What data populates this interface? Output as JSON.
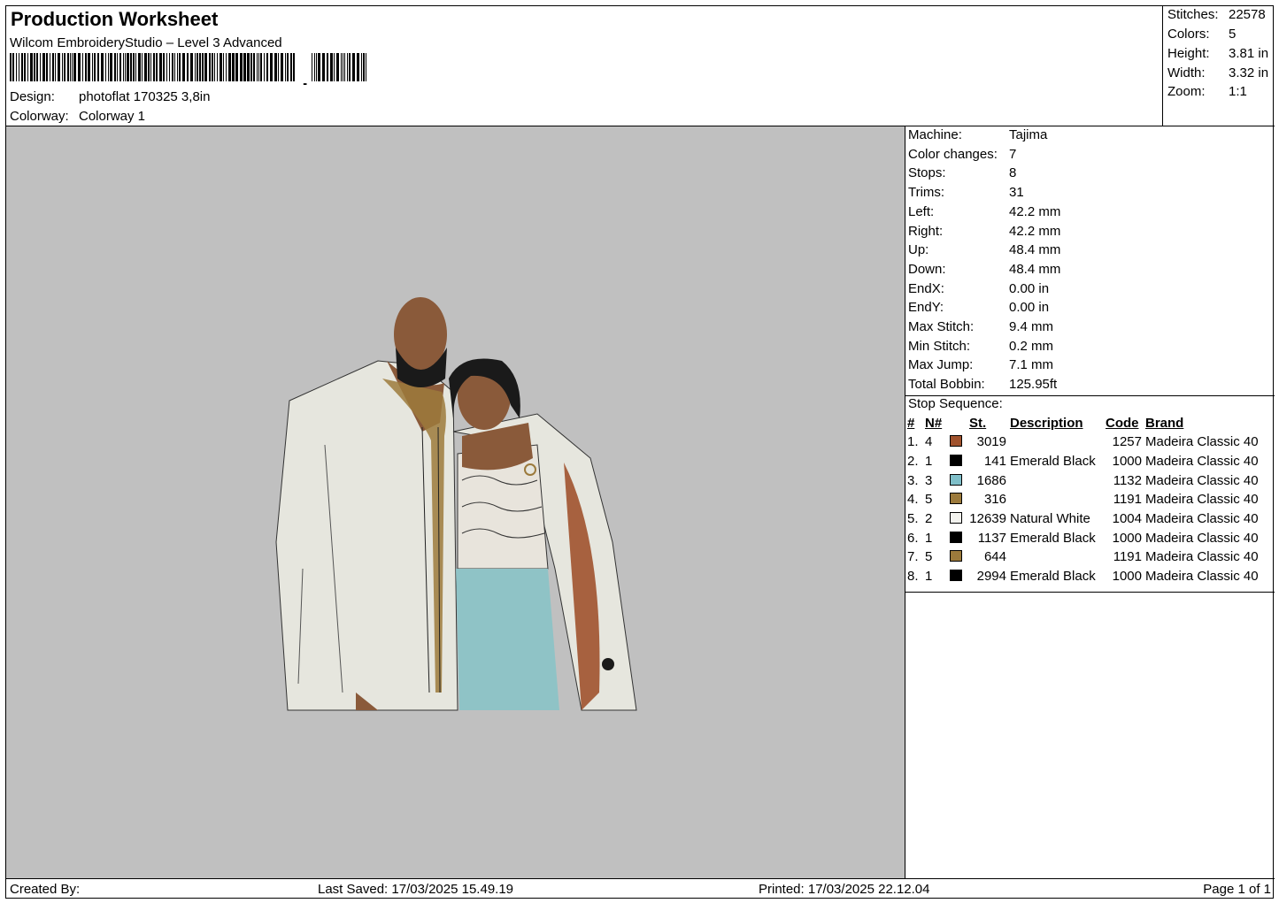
{
  "header": {
    "title": "Production Worksheet",
    "subtitle": "Wilcom EmbroideryStudio – Level 3 Advanced",
    "design_label": "Design:",
    "design_value": "photoflat 170325 3,8in",
    "colorway_label": "Colorway:",
    "colorway_value": "Colorway 1"
  },
  "summary": {
    "stitches_label": "Stitches:",
    "stitches": "22578",
    "colors_label": "Colors:",
    "colors": "5",
    "height_label": "Height:",
    "height": "3.81 in",
    "width_label": "Width:",
    "width": "3.32 in",
    "zoom_label": "Zoom:",
    "zoom": "1:1"
  },
  "machine_info": [
    {
      "label": "Machine:",
      "value": "Tajima"
    },
    {
      "label": "Color changes:",
      "value": "7"
    },
    {
      "label": "Stops:",
      "value": "8"
    },
    {
      "label": "Trims:",
      "value": "31"
    },
    {
      "label": "Left:",
      "value": "42.2 mm"
    },
    {
      "label": "Right:",
      "value": "42.2 mm"
    },
    {
      "label": "Up:",
      "value": "48.4 mm"
    },
    {
      "label": "Down:",
      "value": "48.4 mm"
    },
    {
      "label": "EndX:",
      "value": "0.00 in"
    },
    {
      "label": "EndY:",
      "value": "0.00 in"
    },
    {
      "label": "Max Stitch:",
      "value": "9.4 mm"
    },
    {
      "label": "Min Stitch:",
      "value": "0.2 mm"
    },
    {
      "label": "Max Jump:",
      "value": "7.1 mm"
    },
    {
      "label": "Total Bobbin:",
      "value": "125.95ft"
    }
  ],
  "stop_sequence": {
    "title": "Stop Sequence:",
    "headers": {
      "idx": "#",
      "n": "N#",
      "st": "St.",
      "desc": "Description",
      "code": "Code",
      "brand": "Brand"
    },
    "rows": [
      {
        "idx": "1.",
        "n": "4",
        "color": "#a0522d",
        "st": "3019",
        "desc": "",
        "code": "1257",
        "brand": "Madeira Classic 40"
      },
      {
        "idx": "2.",
        "n": "1",
        "color": "#000000",
        "st": "141",
        "desc": "Emerald Black",
        "code": "1000",
        "brand": "Madeira Classic 40"
      },
      {
        "idx": "3.",
        "n": "3",
        "color": "#7fbfc9",
        "st": "1686",
        "desc": "",
        "code": "1132",
        "brand": "Madeira Classic 40"
      },
      {
        "idx": "4.",
        "n": "5",
        "color": "#9c7a3c",
        "st": "316",
        "desc": "",
        "code": "1191",
        "brand": "Madeira Classic 40"
      },
      {
        "idx": "5.",
        "n": "2",
        "color": "#f2f2ee",
        "st": "12639",
        "desc": "Natural White",
        "code": "1004",
        "brand": "Madeira Classic 40"
      },
      {
        "idx": "6.",
        "n": "1",
        "color": "#000000",
        "st": "1137",
        "desc": "Emerald Black",
        "code": "1000",
        "brand": "Madeira Classic 40"
      },
      {
        "idx": "7.",
        "n": "5",
        "color": "#9c7a3c",
        "st": "644",
        "desc": "",
        "code": "1191",
        "brand": "Madeira Classic 40"
      },
      {
        "idx": "8.",
        "n": "1",
        "color": "#000000",
        "st": "2994",
        "desc": "Emerald Black",
        "code": "1000",
        "brand": "Madeira Classic 40"
      }
    ]
  },
  "footer": {
    "created_by": "Created By:",
    "last_saved": "Last Saved: 17/03/2025 15.49.19",
    "printed": "Printed: 17/03/2025 22.12.04",
    "page": "Page 1 of 1"
  },
  "colors": {
    "preview_bg": "#c0c0c0",
    "skin": "#8a5a3a",
    "garment_white": "#e6e6de",
    "skirt_teal": "#8fc3c6",
    "gold": "#9c7a3c"
  }
}
